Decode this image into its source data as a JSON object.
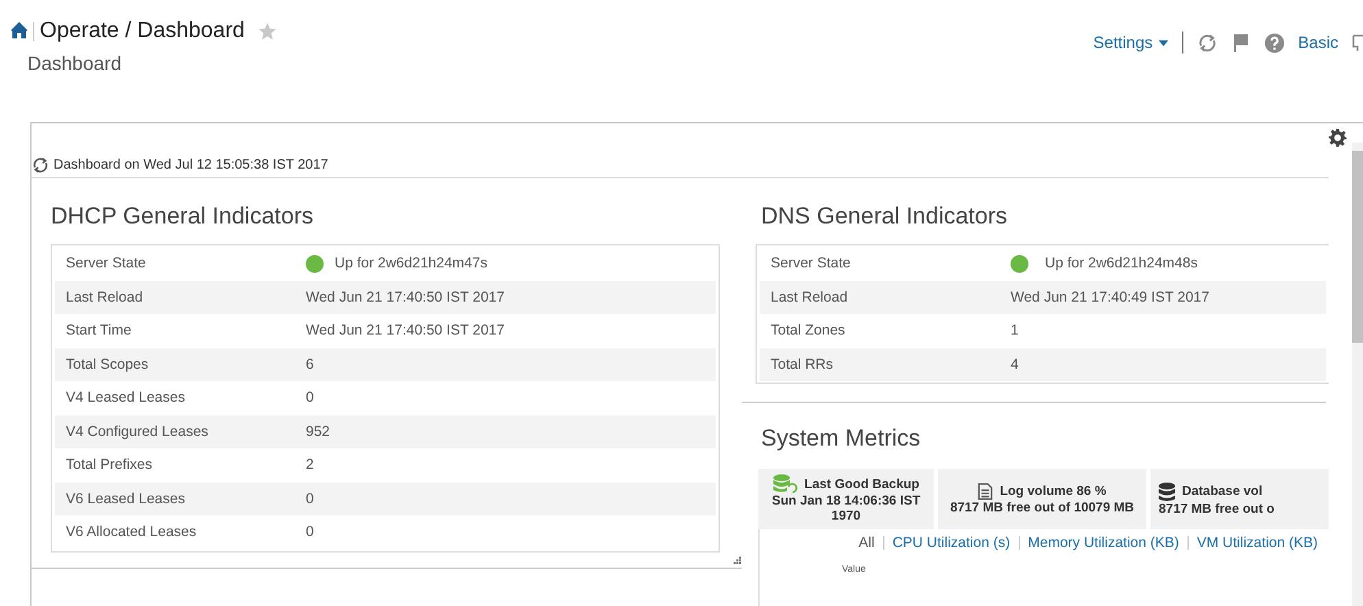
{
  "header": {
    "breadcrumb": "Operate / Dashboard",
    "subtitle": "Dashboard",
    "favorite": false,
    "settings": "Settings",
    "mode": "Basic"
  },
  "timestamp": "Dashboard on Wed Jul 12 15:05:38 IST 2017",
  "dhcp": {
    "title": "DHCP General Indicators",
    "rows": [
      {
        "label": "Server State",
        "value": "Up for 2w6d21h24m47s",
        "kind": "status",
        "color": "#6ab945"
      },
      {
        "label": "Last Reload",
        "value": "Wed Jun 21 17:40:50 IST 2017",
        "kind": "text"
      },
      {
        "label": "Start Time",
        "value": "Wed Jun 21 17:40:50 IST 2017",
        "kind": "text"
      },
      {
        "label": "Total Scopes",
        "value": "6",
        "kind": "text"
      },
      {
        "label": "V4 Leased Leases",
        "value": "0",
        "kind": "text"
      },
      {
        "label": "V4 Configured Leases",
        "value": "952",
        "kind": "text"
      },
      {
        "label": "Total Prefixes",
        "value": "2",
        "kind": "text"
      },
      {
        "label": "V6 Leased Leases",
        "value": "0",
        "kind": "text"
      },
      {
        "label": "V6 Allocated Leases",
        "value": "0",
        "kind": "text"
      }
    ]
  },
  "dns": {
    "title": "DNS General Indicators",
    "rows": [
      {
        "label": "Server State",
        "value": "Up for 2w6d21h24m48s",
        "kind": "status",
        "color": "#6ab945"
      },
      {
        "label": "Last Reload",
        "value": "Wed Jun 21 17:40:49 IST 2017",
        "kind": "text"
      },
      {
        "label": "Total Zones",
        "value": "1",
        "kind": "text"
      },
      {
        "label": "Total RRs",
        "value": "4",
        "kind": "text"
      }
    ]
  },
  "metrics": {
    "title": "System Metrics",
    "tiles": [
      {
        "kind": "backup",
        "title": "Last Good Backup",
        "detail": "Sun Jan 18 14:06:36 IST 1970"
      },
      {
        "kind": "log",
        "title": "Log volume 86 %",
        "detail": "8717 MB free out of 10079 MB"
      },
      {
        "kind": "database",
        "title": "Database vol",
        "detail": "8717 MB free out o"
      }
    ],
    "links": [
      {
        "label": "All",
        "selected": true
      },
      {
        "label": "CPU Utilization (s)",
        "selected": false
      },
      {
        "label": "Memory Utilization (KB)",
        "selected": false
      },
      {
        "label": "VM Utilization (KB)",
        "selected": false
      }
    ],
    "axis_label": "Value"
  }
}
